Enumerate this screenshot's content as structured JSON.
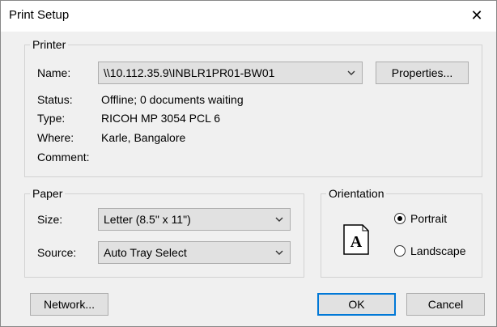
{
  "window": {
    "title": "Print Setup",
    "close_glyph": "✕"
  },
  "printer": {
    "legend": "Printer",
    "name_label": "Name:",
    "name_value": "\\\\10.112.35.9\\INBLR1PR01-BW01",
    "properties_button": "Properties...",
    "status_label": "Status:",
    "status_value": "Offline; 0 documents waiting",
    "type_label": "Type:",
    "type_value": "RICOH MP 3054 PCL 6",
    "where_label": "Where:",
    "where_value": "Karle, Bangalore",
    "comment_label": "Comment:",
    "comment_value": ""
  },
  "paper": {
    "legend": "Paper",
    "size_label": "Size:",
    "size_value": "Letter (8.5\" x 11\")",
    "source_label": "Source:",
    "source_value": "Auto Tray Select"
  },
  "orientation": {
    "legend": "Orientation",
    "page_glyph": "A",
    "portrait_label": "Portrait",
    "landscape_label": "Landscape",
    "selected": "Portrait"
  },
  "buttons": {
    "network": "Network...",
    "ok": "OK",
    "cancel": "Cancel"
  },
  "colors": {
    "accent": "#0078d7",
    "button_face": "#e1e1e1",
    "dialog_bg": "#f0f0f0"
  }
}
